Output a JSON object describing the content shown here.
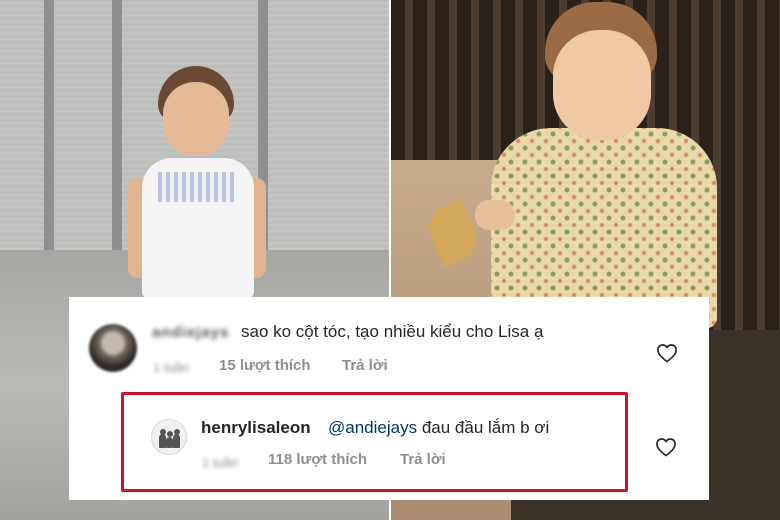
{
  "comments": [
    {
      "username": "andiejays",
      "text": "sao ko cột tóc, tạo nhiều kiểu cho Lisa ạ",
      "time": "1 tuần",
      "likes": "15 lượt thích",
      "reply_label": "Trả lời"
    },
    {
      "username": "henrylisaleon",
      "mention": "@andiejays",
      "text": "đau đầu lắm b ơi",
      "time": "1 tuần",
      "likes": "118 lượt thích",
      "reply_label": "Trả lời"
    }
  ],
  "colors": {
    "highlight_border": "#c8152a",
    "mention": "#00376b",
    "text": "#262626",
    "secondary": "#8e8e8e"
  },
  "icons": {
    "like": "heart-outline-icon"
  }
}
